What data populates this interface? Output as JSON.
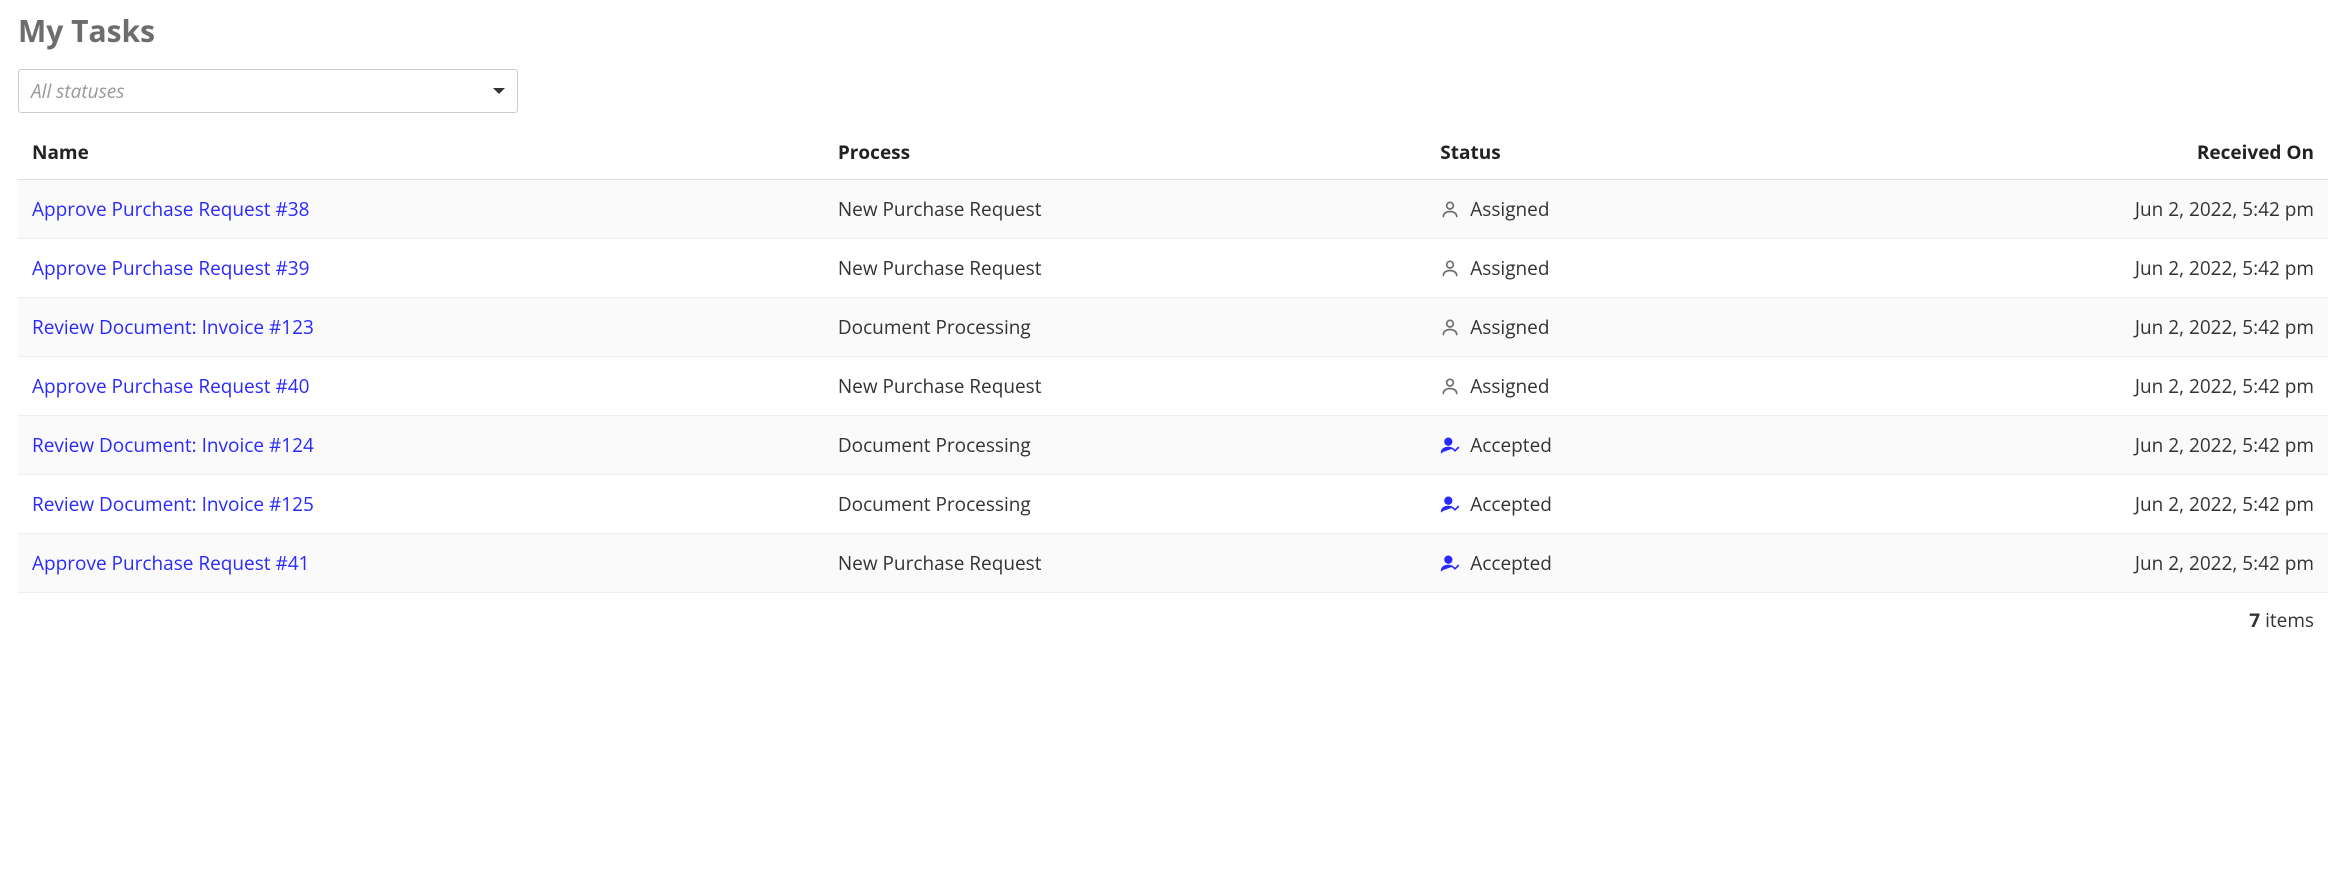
{
  "page_title": "My Tasks",
  "filter": {
    "placeholder": "All statuses"
  },
  "columns": {
    "name": "Name",
    "process": "Process",
    "status": "Status",
    "received_on": "Received On"
  },
  "tasks": [
    {
      "name": "Approve Purchase Request #38",
      "process": "New Purchase Request",
      "status": "Assigned",
      "status_icon": "person-icon",
      "received_on": "Jun 2, 2022, 5:42 pm"
    },
    {
      "name": "Approve Purchase Request #39",
      "process": "New Purchase Request",
      "status": "Assigned",
      "status_icon": "person-icon",
      "received_on": "Jun 2, 2022, 5:42 pm"
    },
    {
      "name": "Review Document: Invoice #123",
      "process": "Document Processing",
      "status": "Assigned",
      "status_icon": "person-icon",
      "received_on": "Jun 2, 2022, 5:42 pm"
    },
    {
      "name": "Approve Purchase Request #40",
      "process": "New Purchase Request",
      "status": "Assigned",
      "status_icon": "person-icon",
      "received_on": "Jun 2, 2022, 5:42 pm"
    },
    {
      "name": "Review Document: Invoice #124",
      "process": "Document Processing",
      "status": "Accepted",
      "status_icon": "person-check-icon",
      "received_on": "Jun 2, 2022, 5:42 pm"
    },
    {
      "name": "Review Document: Invoice #125",
      "process": "Document Processing",
      "status": "Accepted",
      "status_icon": "person-check-icon",
      "received_on": "Jun 2, 2022, 5:42 pm"
    },
    {
      "name": "Approve Purchase Request #41",
      "process": "New Purchase Request",
      "status": "Accepted",
      "status_icon": "person-check-icon",
      "received_on": "Jun 2, 2022, 5:42 pm"
    }
  ],
  "footer": {
    "count": "7",
    "items_label": " items"
  },
  "icons": {
    "person-icon": {
      "color": "#6d6d6d",
      "fill": "none"
    },
    "person-check-icon": {
      "color": "#2a2aff",
      "fill": "#2a2aff"
    }
  }
}
